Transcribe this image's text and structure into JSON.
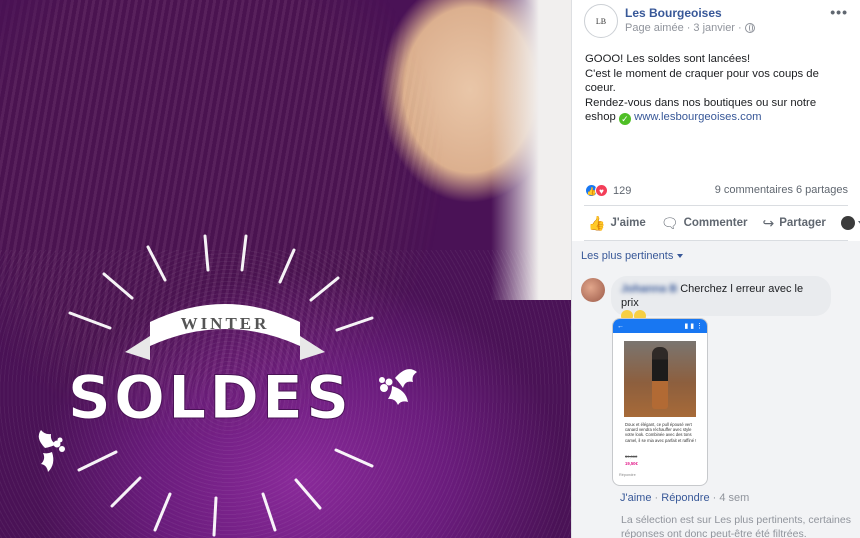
{
  "image": {
    "badge_top": "WINTER",
    "badge_main": "SOLDES"
  },
  "post": {
    "page_name": "Les Bourgeoises",
    "avatar_text": "LB",
    "meta_liked": "Page aimée",
    "meta_dot": "·",
    "meta_date": "3 janvier",
    "more_label": "•••",
    "text_line1": "GOOO! Les soldes sont lancées!",
    "text_line2": "C'est le moment de craquer pour vos coups de coeur.",
    "text_line3": "Rendez-vous dans nos boutiques ou sur notre eshop",
    "check_glyph": "✓",
    "link": "www.lesbourgeoises.com",
    "reaction_count": "129",
    "comments_shares": "9 commentaires  6 partages",
    "like_label": "J'aime",
    "comment_label": "Commenter",
    "share_label": "Partager"
  },
  "comments": {
    "sort_label": "Les plus pertinents",
    "comment": {
      "author": "Johanna B",
      "text": "Cherchez l erreur avec le prix",
      "reply_like": "J'aime",
      "reply_sep": "·",
      "reply": "Répondre",
      "age": "4 sem"
    },
    "phone": {
      "caption": "Doux et élégant, ce pull épousé vert canard vendra réchauffer avec style votre look. Combinée avec des tons camel, il se mia avec parfait et raffiné !",
      "price_old": "39,00€",
      "price_new": "19,50€",
      "footer": "Répondre"
    },
    "filter_note": "La sélection est sur Les plus pertinents, certaines réponses ont donc peut-être été filtrées."
  }
}
